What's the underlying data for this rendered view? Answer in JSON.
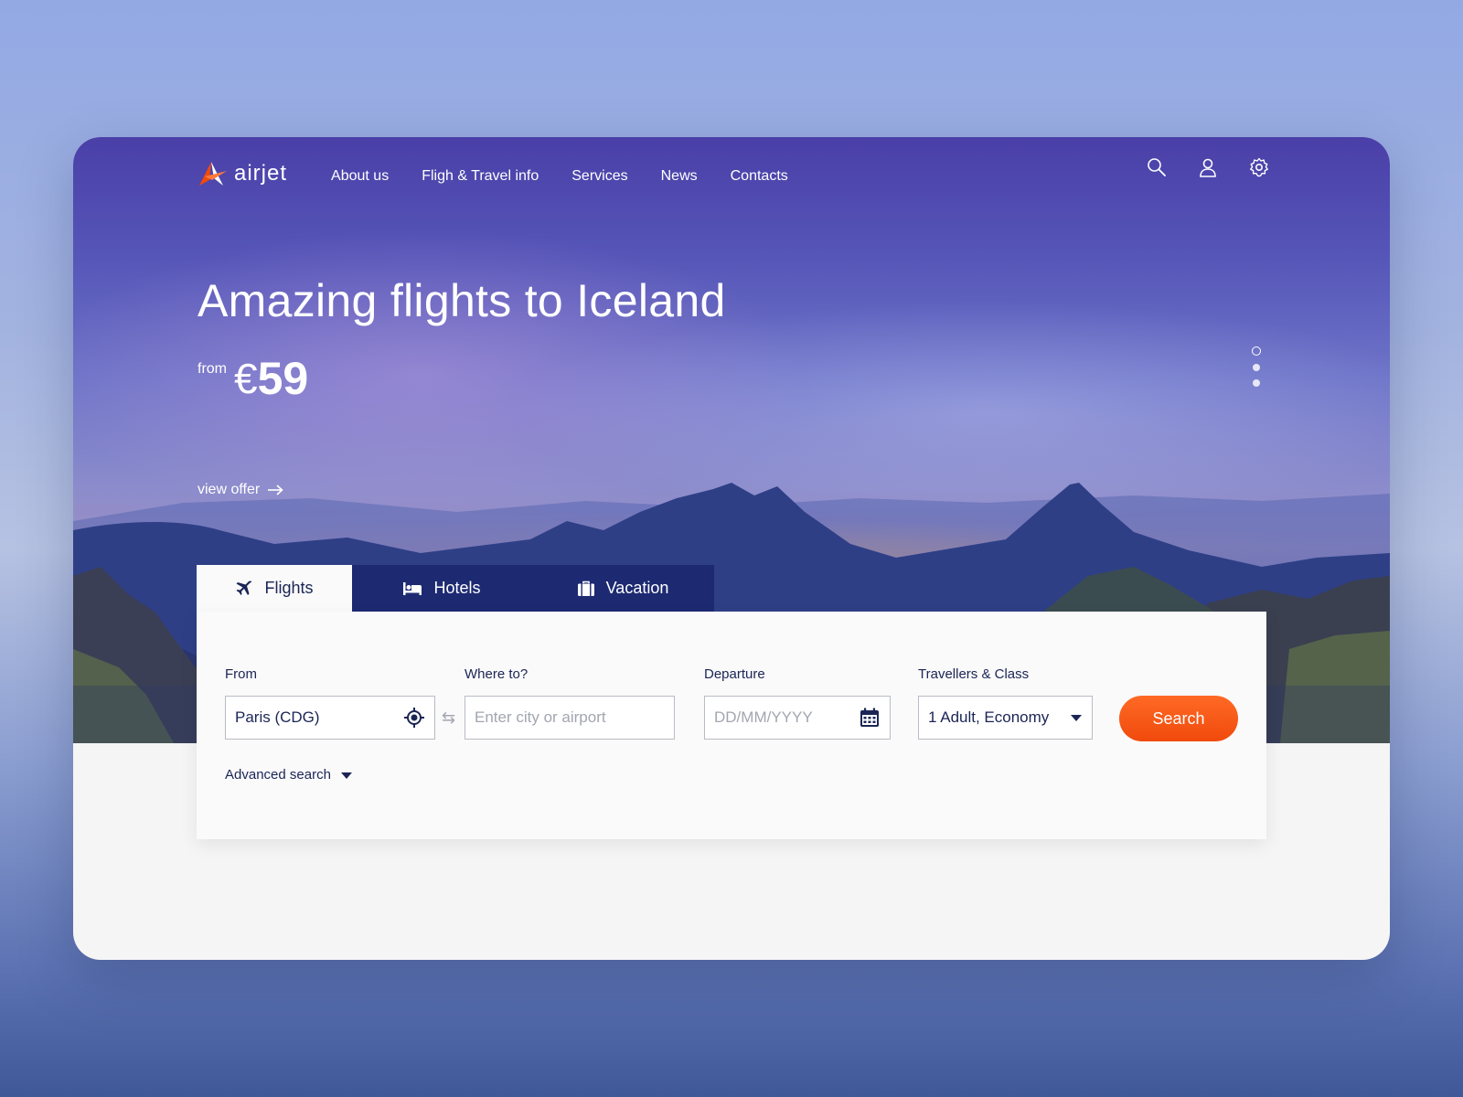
{
  "brand": {
    "name": "airjet",
    "accent": "#f04a0c",
    "navy": "#1b2555"
  },
  "nav": {
    "items": [
      "About us",
      "Fligh & Travel info",
      "Services",
      "News",
      "Contacts"
    ],
    "icons": [
      "search-icon",
      "user-icon",
      "settings-icon"
    ]
  },
  "hero": {
    "headline": "Amazing flights to Iceland",
    "price_prefix": "from",
    "currency": "€",
    "price": "59",
    "cta": "view offer",
    "slides": {
      "count": 3,
      "active": 1
    }
  },
  "tabs": [
    {
      "label": "Flights",
      "icon": "plane-icon",
      "active": true
    },
    {
      "label": "Hotels",
      "icon": "bed-icon",
      "active": false
    },
    {
      "label": "Vacation",
      "icon": "suitcase-icon",
      "active": false
    }
  ],
  "search": {
    "from": {
      "label": "From",
      "value": "Paris (CDG)"
    },
    "to": {
      "label": "Where to?",
      "placeholder": "Enter city or airport"
    },
    "departure": {
      "label": "Departure",
      "placeholder": "DD/MM/YYYY"
    },
    "travellers": {
      "label": "Travellers & Class",
      "value": "1 Adult, Economy"
    },
    "button": "Search",
    "advanced": "Advanced search"
  }
}
